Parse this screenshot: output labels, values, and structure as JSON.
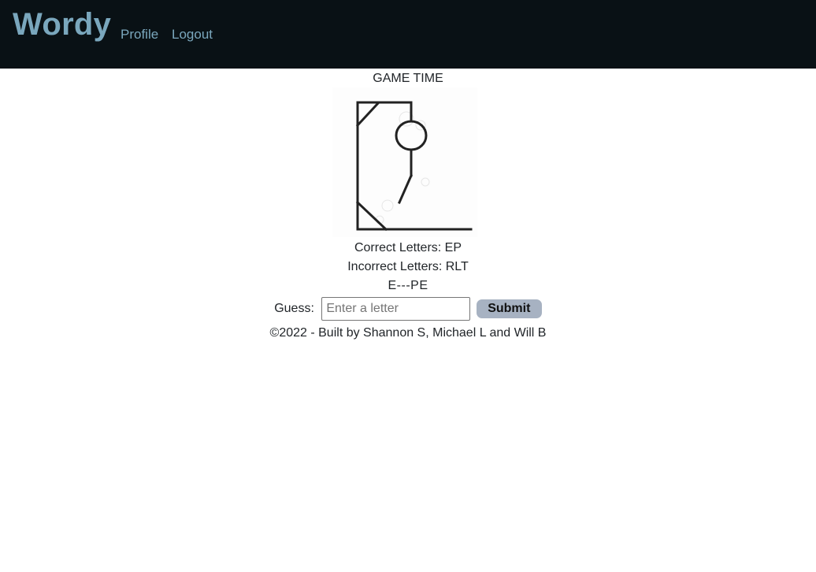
{
  "navbar": {
    "brand": "Wordy",
    "links": [
      "Profile",
      "Logout"
    ],
    "background": "#091115",
    "link_color": "#7aa7bd"
  },
  "game": {
    "heading": "GAME TIME",
    "hangman_image": "hangman-stage-drawing",
    "correct_letters": "Correct Letters: EP",
    "incorrect_letters": "Incorrect Letters: RLT",
    "word_display": "E---PE"
  },
  "guess_form": {
    "label": "Guess:",
    "placeholder": "Enter a letter",
    "value": "",
    "submit_label": "Submit",
    "button_color": "#a7b2c2"
  },
  "footer": {
    "text": "©2022 - Built by Shannon S, Michael L and Will B"
  }
}
